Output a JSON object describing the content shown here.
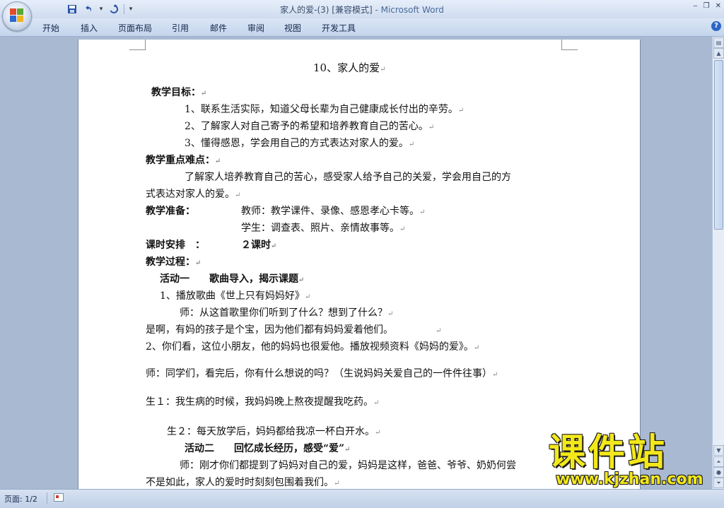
{
  "window": {
    "title": "家人的爱-(3) [兼容模式]",
    "app_suffix": " - Microsoft Word"
  },
  "quick_access": {
    "save_icon": "save-icon",
    "undo_icon": "undo-icon",
    "redo_icon": "redo-icon"
  },
  "ribbon": {
    "tabs": [
      "开始",
      "插入",
      "页面布局",
      "引用",
      "邮件",
      "审阅",
      "视图",
      "开发工具"
    ]
  },
  "document": {
    "title": "10、家人的爱",
    "lines": [
      "教学目标：",
      "1、联系生活实际，知道父母长辈为自己健康成长付出的辛劳。",
      "2、了解家人对自己寄予的希望和培养教育自己的苦心。",
      "3、懂得感恩，学会用自己的方式表达对家人的爱。",
      "教学重点难点：",
      "了解家人培养教育自己的苦心，感受家人给予自己的关爱，学会用自己的方",
      "式表达对家人的爱。",
      "教学准备：",
      "教师：教学课件、录像、感恩孝心卡等。",
      "学生：调查表、照片、亲情故事等。",
      "课时安排　：",
      "２课时",
      "教学过程：",
      "活动一　　歌曲导入，揭示课题",
      "1、播放歌曲《世上只有妈妈好》",
      "师：从这首歌里你们听到了什么？想到了什么？",
      "是啊，有妈的孩子是个宝，因为他们都有妈妈爱着他们。",
      "2、你们看，这位小朋友，他的妈妈也很爱他。播放视频资料《妈妈的爱》。",
      "师：同学们，看完后，你有什么想说的吗？（生说妈妈关爱自己的一件件往事）",
      "生１：我生病的时候，我妈妈晚上熬夜提醒我吃药。",
      "生２：每天放学后，妈妈都给我凉一杯白开水。",
      "活动二　　回忆成长经历，感受“爱”",
      "师：刚才你们都提到了妈妈对自己的爱，妈妈是这样，爸爸、爷爷、奶奶何尝",
      "不是如此，家人的爱时时刻刻包围着我们。"
    ],
    "paragraph_mark": "↵"
  },
  "statusbar": {
    "page_info": "页面: 1/2"
  },
  "watermark": {
    "brand": "课件站",
    "url": "www.kjzhan.com"
  },
  "colors": {
    "office_red": "#e24b2b",
    "office_green": "#5aa832",
    "office_blue": "#2b6ad1",
    "office_yellow": "#f0b41f",
    "watermark_yellow": "#f3e81a"
  }
}
